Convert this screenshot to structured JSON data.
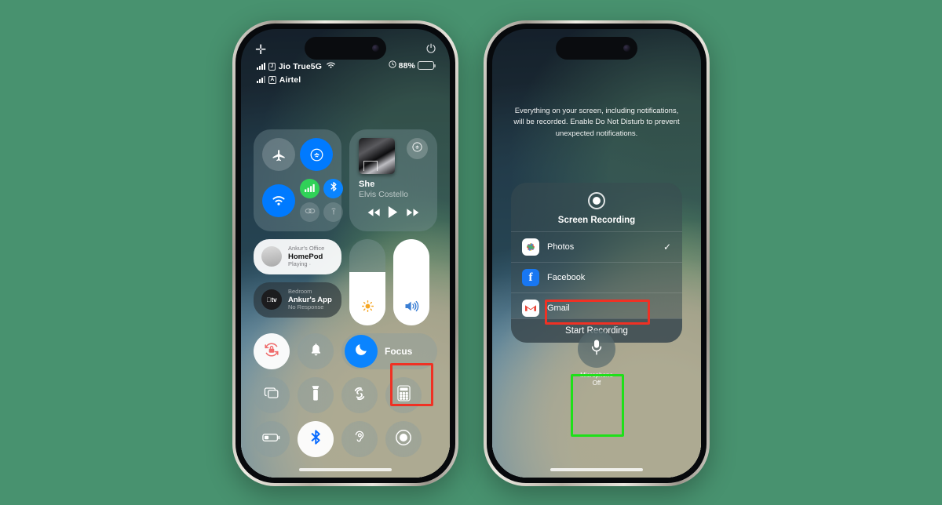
{
  "background_color": "#48926f",
  "annotation_colors": {
    "red": "#ef3124",
    "green": "#1ee019"
  },
  "left_phone": {
    "top_bar": {
      "add_icon": "plus-icon",
      "power_icon": "power-icon"
    },
    "status_bar": {
      "carrier_primary": "Jio True5G",
      "carrier_secondary": "Airtel",
      "sim_primary_badge": "J",
      "sim_secondary_badge": "A",
      "wifi_icon": "wifi-icon",
      "alarm_icon": "alarm-icon",
      "battery_percent": "88%",
      "battery_level": 88
    },
    "connectivity": {
      "airplane_mode": "airplane-icon",
      "airdrop_large": "airdrop-icon",
      "wifi": "wifi-icon",
      "cellular_data": "cellular-icon",
      "bluetooth": "bluetooth-icon",
      "airdrop_small": "airdrop-off-icon",
      "hotspot": "hotspot-icon"
    },
    "media": {
      "title": "She",
      "artist": "Elvis Costello",
      "airplay_icon": "airplay-icon",
      "rewind_icon": "rewind-icon",
      "play_icon": "play-icon",
      "forward_icon": "forward-icon"
    },
    "accessories": [
      {
        "room": "Ankur's Office",
        "name": "HomePod",
        "state": "Playing ·",
        "icon": "homepod-icon",
        "theme": "light"
      },
      {
        "room": "Bedroom",
        "name": "Ankur's App",
        "state": "No Response",
        "icon": "appletv-icon",
        "theme": "dark"
      }
    ],
    "sliders": {
      "brightness": {
        "icon": "brightness-icon",
        "value": 62
      },
      "volume": {
        "icon": "volume-icon",
        "value": 100
      }
    },
    "controls_row_1": [
      {
        "name": "rotation-lock",
        "icon": "rotation-lock-icon",
        "active": true
      },
      {
        "name": "silent-mode",
        "icon": "bell-icon",
        "active": false
      }
    ],
    "focus": {
      "label": "Focus",
      "icon": "moon-icon"
    },
    "controls_row_2": [
      {
        "name": "screen-mirroring",
        "icon": "screen-mirroring-icon"
      },
      {
        "name": "flashlight",
        "icon": "flashlight-icon"
      },
      {
        "name": "shazam",
        "icon": "shazam-icon"
      },
      {
        "name": "calculator",
        "icon": "calculator-icon"
      }
    ],
    "controls_row_3": [
      {
        "name": "low-power-mode",
        "icon": "battery-icon"
      },
      {
        "name": "bluetooth-shortcut",
        "icon": "bluetooth-icon",
        "active": true
      },
      {
        "name": "hearing",
        "icon": "hearing-icon"
      },
      {
        "name": "screen-recording",
        "icon": "record-icon",
        "highlighted": true
      }
    ]
  },
  "right_phone": {
    "description": "Everything on your screen, including notifications, will be recorded. Enable Do Not Disturb to prevent unexpected notifications.",
    "sheet": {
      "icon": "record-icon",
      "title": "Screen Recording",
      "options": [
        {
          "label": "Photos",
          "icon": "photos-icon",
          "selected": true
        },
        {
          "label": "Facebook",
          "icon": "facebook-icon",
          "selected": false
        },
        {
          "label": "Gmail",
          "icon": "gmail-icon",
          "selected": false
        }
      ],
      "start_button": "Start Recording"
    },
    "microphone": {
      "icon": "microphone-icon",
      "label_line1": "Microphone",
      "label_line2": "Off"
    }
  }
}
